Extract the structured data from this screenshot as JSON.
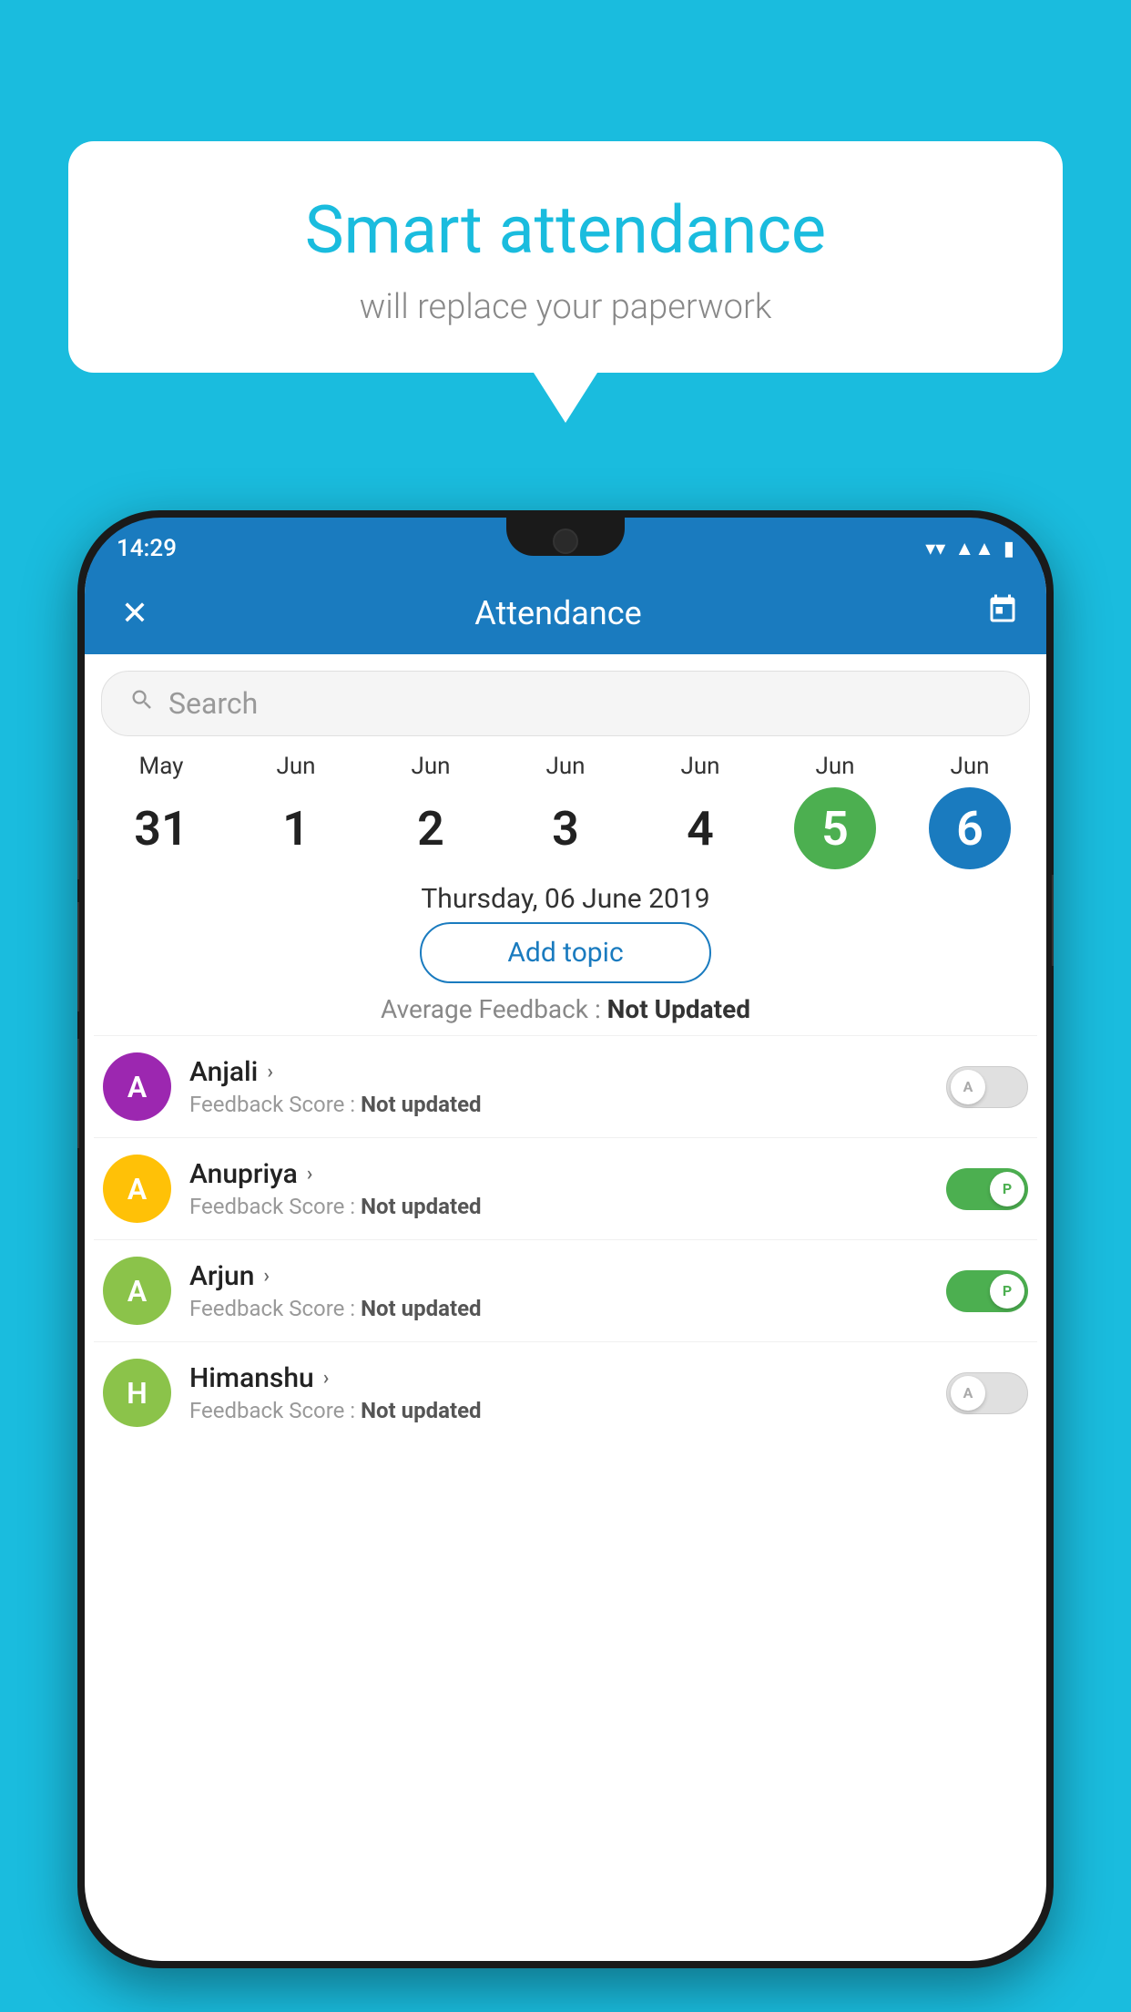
{
  "background_color": "#1ABCDE",
  "speech_bubble": {
    "title": "Smart attendance",
    "subtitle": "will replace your paperwork"
  },
  "status_bar": {
    "time": "14:29",
    "wifi": "▾",
    "signal": "▲",
    "battery": "▮"
  },
  "app_header": {
    "close_label": "✕",
    "title": "Attendance",
    "calendar_icon": "🗓"
  },
  "search": {
    "placeholder": "Search"
  },
  "date_picker": {
    "items": [
      {
        "month": "May",
        "day": "31",
        "selected": false
      },
      {
        "month": "Jun",
        "day": "1",
        "selected": false
      },
      {
        "month": "Jun",
        "day": "2",
        "selected": false
      },
      {
        "month": "Jun",
        "day": "3",
        "selected": false
      },
      {
        "month": "Jun",
        "day": "4",
        "selected": false
      },
      {
        "month": "Jun",
        "day": "5",
        "selected": "green"
      },
      {
        "month": "Jun",
        "day": "6",
        "selected": "blue"
      }
    ]
  },
  "selected_date": "Thursday, 06 June 2019",
  "add_topic_label": "Add topic",
  "avg_feedback_label": "Average Feedback : ",
  "avg_feedback_value": "Not Updated",
  "students": [
    {
      "name": "Anjali",
      "avatar_letter": "A",
      "avatar_color": "#9C27B0",
      "feedback_label": "Feedback Score : ",
      "feedback_value": "Not updated",
      "toggle_state": "off",
      "toggle_letter": "A"
    },
    {
      "name": "Anupriya",
      "avatar_letter": "A",
      "avatar_color": "#FFC107",
      "feedback_label": "Feedback Score : ",
      "feedback_value": "Not updated",
      "toggle_state": "on",
      "toggle_letter": "P"
    },
    {
      "name": "Arjun",
      "avatar_letter": "A",
      "avatar_color": "#8BC34A",
      "feedback_label": "Feedback Score : ",
      "feedback_value": "Not updated",
      "toggle_state": "on",
      "toggle_letter": "P"
    },
    {
      "name": "Himanshu",
      "avatar_letter": "H",
      "avatar_color": "#8BC34A",
      "feedback_label": "Feedback Score : ",
      "feedback_value": "Not updated",
      "toggle_state": "off",
      "toggle_letter": "A"
    }
  ]
}
